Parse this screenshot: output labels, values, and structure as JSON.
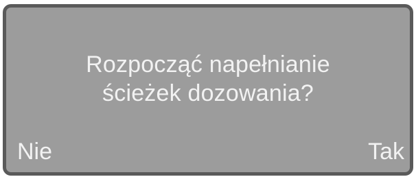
{
  "dialog": {
    "message_line1": "Rozpocząć napełnianie",
    "message_line2": "ścieżek dozowania?",
    "left_softkey": "Nie",
    "right_softkey": "Tak"
  },
  "colors": {
    "screen_background": "#9c9c9c",
    "frame_border": "#5a5a5a",
    "text": "#f2f2f2"
  }
}
